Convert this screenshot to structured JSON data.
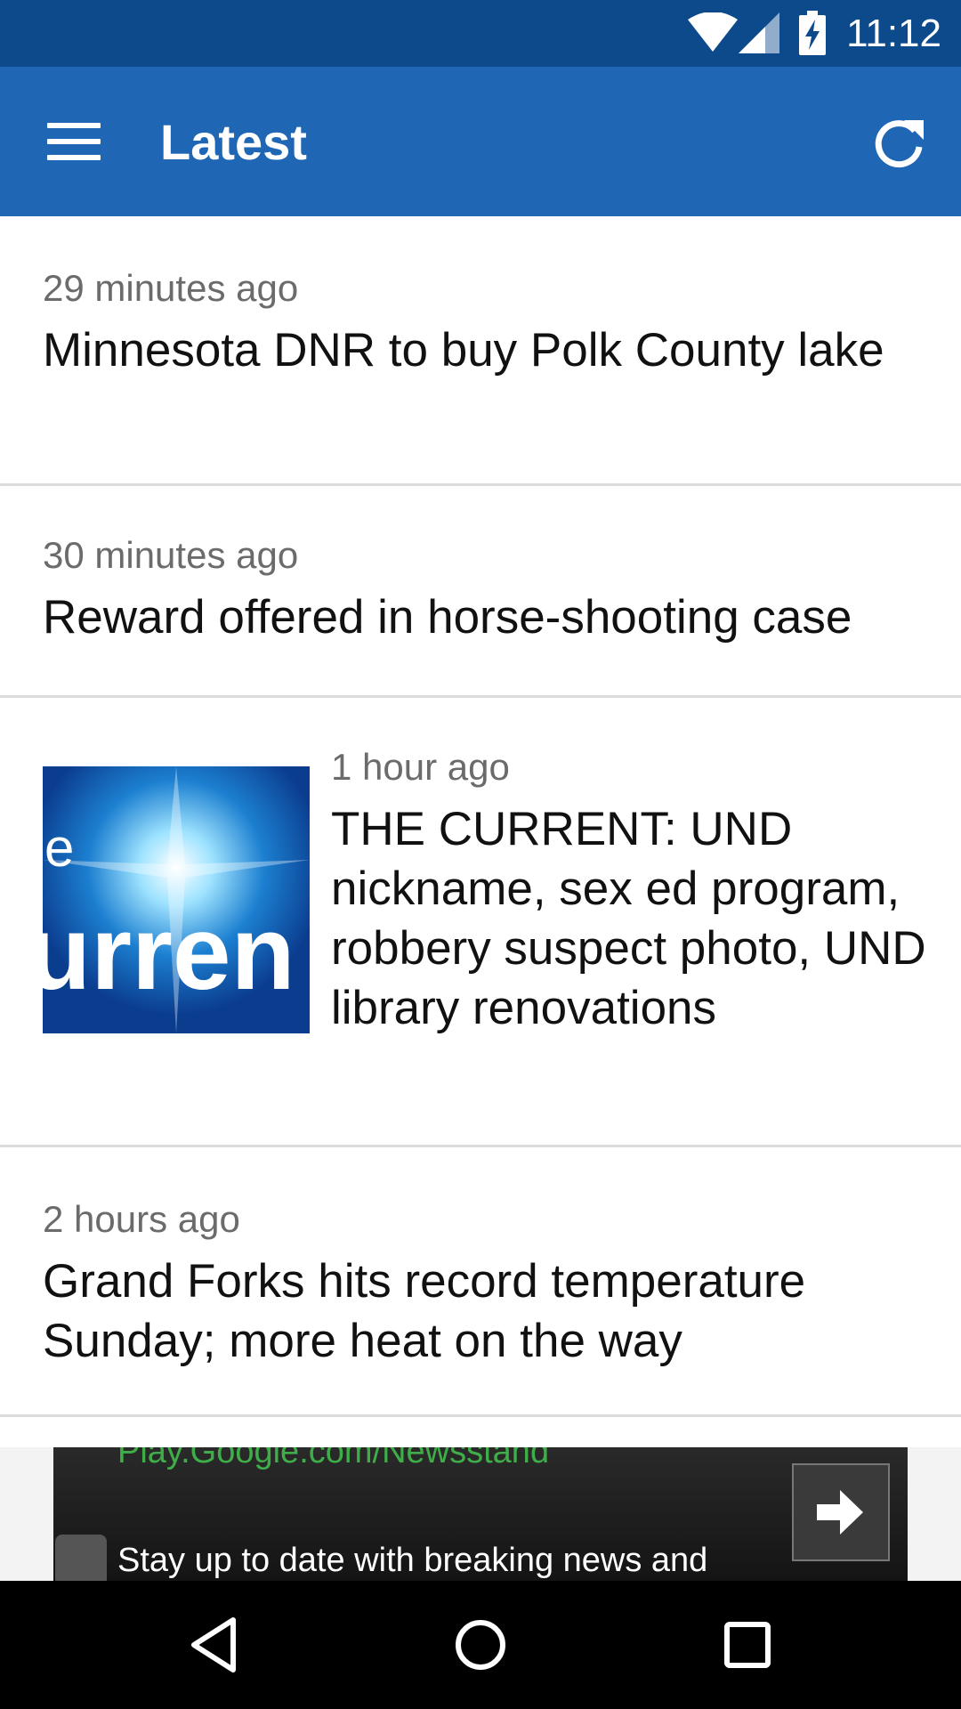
{
  "status_bar": {
    "time": "11:12",
    "icons": [
      "wifi-icon",
      "cell-signal-icon",
      "battery-charging-icon"
    ]
  },
  "app_bar": {
    "title": "Latest",
    "color": "#1f66b5",
    "icons": [
      "hamburger-menu-icon",
      "refresh-icon"
    ]
  },
  "articles": [
    {
      "time": "29 minutes ago",
      "headline": "Minnesota DNR to buy Polk County lake",
      "has_thumbnail": false
    },
    {
      "time": "30 minutes ago",
      "headline": "Reward offered in horse-shooting case",
      "has_thumbnail": false
    },
    {
      "time": "1 hour ago",
      "headline": "THE CURRENT: UND nickname, sex ed program, robbery suspect photo, UND library renovations",
      "has_thumbnail": true,
      "thumbnail_text": [
        "e",
        "urren"
      ]
    },
    {
      "time": "2 hours ago",
      "headline": "Grand Forks hits record temperature Sunday; more heat on the way",
      "has_thumbnail": false
    }
  ],
  "ad": {
    "url_text": "Play.Google.com/Newsstand",
    "description": "Stay up to date with breaking news and",
    "url_color": "#3fae49"
  },
  "nav_bar": {
    "icons": [
      "back-icon",
      "home-icon",
      "recents-icon"
    ]
  }
}
